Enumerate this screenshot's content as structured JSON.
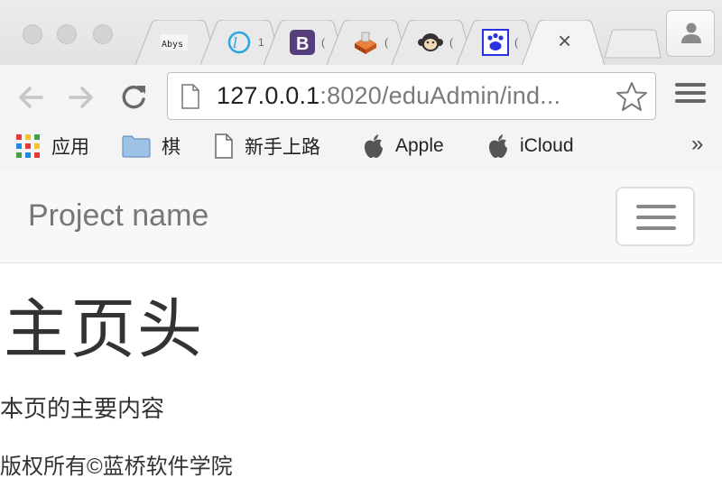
{
  "browser": {
    "tabs": [
      {
        "icon": "abys-icon",
        "sliver": ""
      },
      {
        "icon": "q-icon",
        "sliver": "1"
      },
      {
        "icon": "bootstrap-icon",
        "sliver": "("
      },
      {
        "icon": "box-icon",
        "sliver": "("
      },
      {
        "icon": "monkey-icon",
        "sliver": "("
      },
      {
        "icon": "paw-icon",
        "sliver": "("
      },
      {
        "icon": "close-icon",
        "close_glyph": "×",
        "active": true
      }
    ],
    "address_bar": {
      "url_host": "127.0.0.1",
      "url_rest": ":8020/eduAdmin/ind..."
    },
    "bookmarks": [
      {
        "icon": "apps-grid-icon",
        "label": "应用"
      },
      {
        "icon": "folder-icon",
        "label": "棋"
      },
      {
        "icon": "page-icon",
        "label": "新手上路"
      },
      {
        "icon": "apple-icon",
        "label": "Apple"
      },
      {
        "icon": "apple-icon",
        "label": "iCloud"
      }
    ],
    "bookmarks_more": "»"
  },
  "navbar": {
    "brand": "Project name"
  },
  "main": {
    "heading": "主页头",
    "content": "本页的主要内容"
  },
  "footer": {
    "copyright": "版权所有©蓝桥软件学院"
  },
  "colors": {
    "bootstrap_purple": "#563d7c",
    "paw_blue": "#2932e1",
    "q_blue": "#2aa8e0",
    "box_orange": "#c2551a"
  }
}
